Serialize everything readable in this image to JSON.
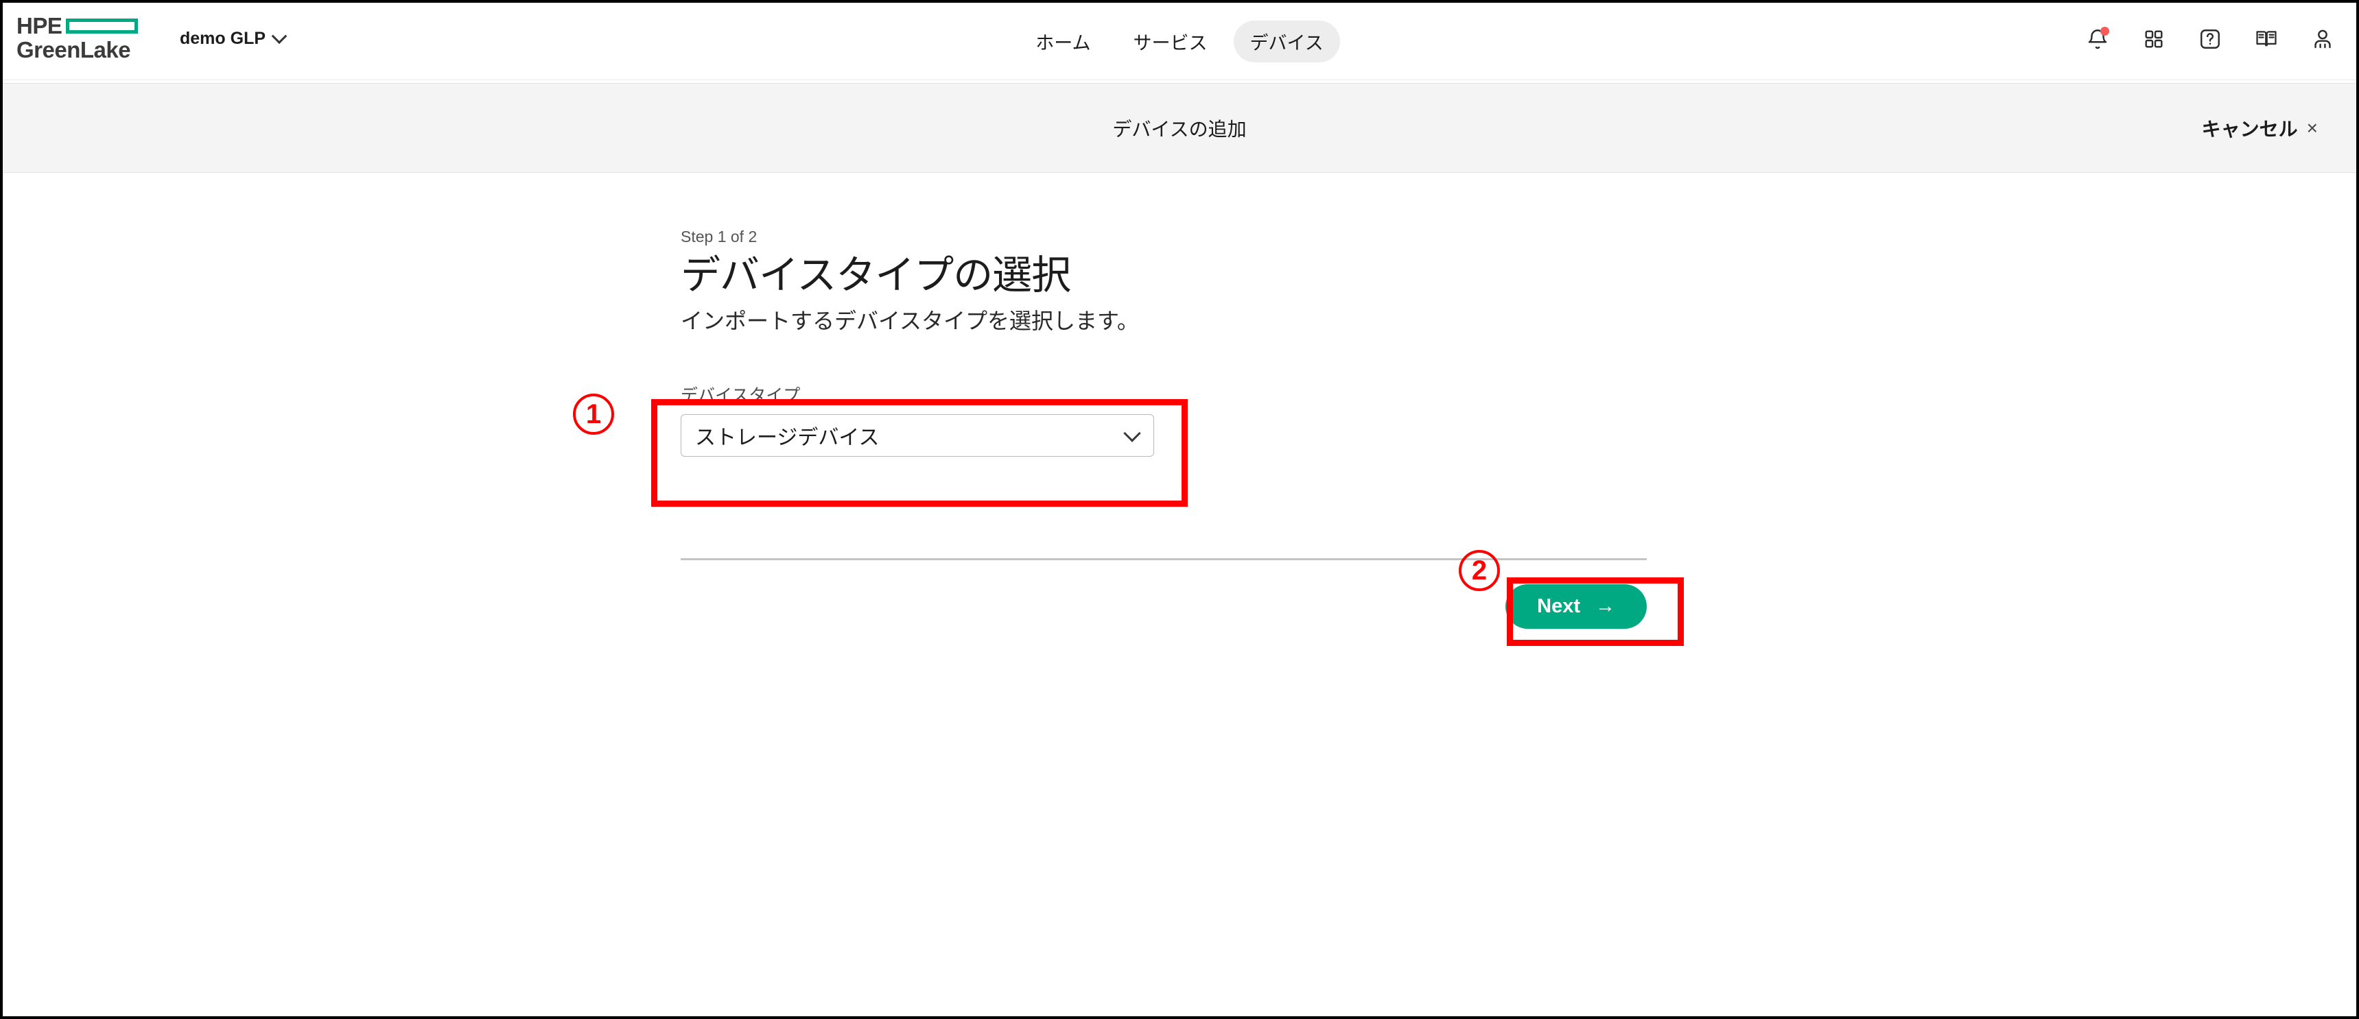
{
  "header": {
    "logo": {
      "line1": "HPE",
      "line2": "GreenLake",
      "mark_color": "#01a982"
    },
    "workspace": {
      "name": "demo GLP",
      "chevron_icon": "chevron-down-icon"
    },
    "nav_items": [
      {
        "label": "ホーム",
        "active": false
      },
      {
        "label": "サービス",
        "active": false
      },
      {
        "label": "デバイス",
        "active": true
      }
    ],
    "icons": [
      {
        "name": "notifications-bell-icon",
        "badge": true
      },
      {
        "name": "apps-grid-icon",
        "badge": false
      },
      {
        "name": "help-question-icon",
        "badge": false
      },
      {
        "name": "documentation-book-icon",
        "badge": false
      },
      {
        "name": "user-profile-icon",
        "badge": false
      }
    ],
    "badge_color": "#fc5a5a"
  },
  "sub_header": {
    "title": "デバイスの追加",
    "cancel_label": "キャンセル",
    "cancel_close_glyph": "×"
  },
  "wizard": {
    "step_label": "Step 1 of 2",
    "title": "デバイスタイプの選択",
    "subtitle": "インポートするデバイスタイプを選択します。",
    "field": {
      "label": "デバイスタイプ",
      "value": "ストレージデバイス",
      "chevron_icon": "chevron-down-icon"
    },
    "next_button": {
      "label": "Next",
      "arrow_glyph": "→",
      "color": "#01a982"
    }
  },
  "annotations": {
    "marker_color": "#ff0000",
    "markers": [
      {
        "number": "①",
        "digit": "1",
        "target": "device-type-select"
      },
      {
        "number": "②",
        "digit": "2",
        "target": "next-button"
      }
    ]
  }
}
